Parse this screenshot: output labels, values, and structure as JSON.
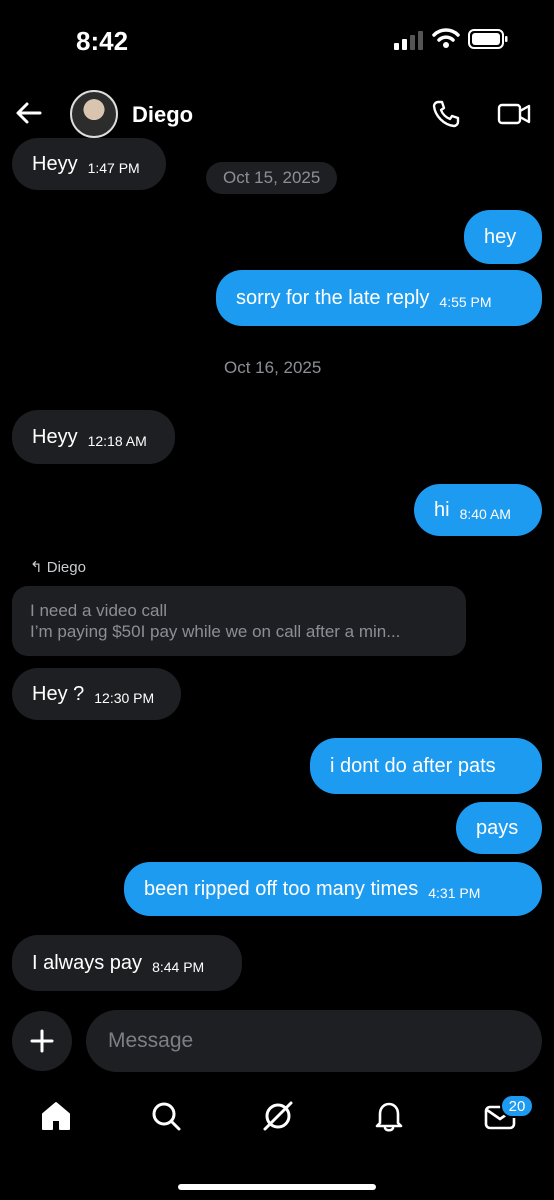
{
  "status_bar": {
    "time": "8:42"
  },
  "header": {
    "contact_name": "Diego"
  },
  "messages": [
    {
      "text": "Heyy",
      "time": "1:47 PM"
    },
    {
      "text": "hey"
    },
    {
      "text": "sorry for the late reply",
      "time": "4:55 PM"
    },
    {
      "text": "Heyy",
      "time": "12:18 AM"
    },
    {
      "text": "hi",
      "time": "8:40 AM"
    },
    {
      "text": "Hey ?",
      "time": "12:30 PM"
    },
    {
      "text": "i dont do after pats"
    },
    {
      "text": "pays"
    },
    {
      "text": "been ripped off too many times",
      "time": "4:31 PM"
    },
    {
      "text": "I always pay",
      "time": "8:44 PM"
    }
  ],
  "dates": [
    "Oct 15, 2025",
    "Oct 16, 2025"
  ],
  "reply": {
    "label": "Diego",
    "line1": "I need a video call",
    "line2": "I’m paying $50I pay while we on call after a min..."
  },
  "composer": {
    "placeholder": "Message"
  },
  "bottom_nav": {
    "badge_count": "20"
  },
  "colors": {
    "accent": "#1d9bf0",
    "bubble_incoming": "#1e1f22",
    "background": "#000000"
  }
}
